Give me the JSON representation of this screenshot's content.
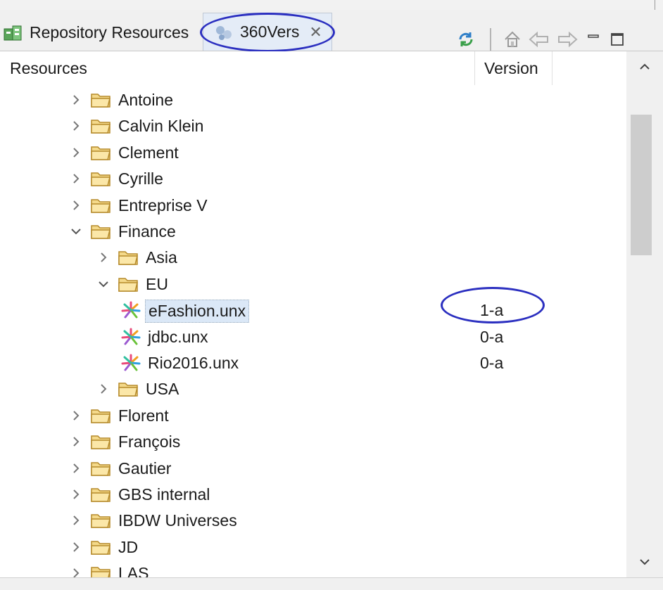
{
  "tabs": {
    "repository_label": "Repository Resources",
    "active_label": "360Vers",
    "active_close": "✕"
  },
  "columns": {
    "resources": "Resources",
    "version": "Version"
  },
  "tree": [
    {
      "label": "Antoine",
      "level": 0,
      "expanded": false,
      "type": "folder",
      "version": ""
    },
    {
      "label": "Calvin Klein",
      "level": 0,
      "expanded": false,
      "type": "folder",
      "version": ""
    },
    {
      "label": "Clement",
      "level": 0,
      "expanded": false,
      "type": "folder",
      "version": ""
    },
    {
      "label": "Cyrille",
      "level": 0,
      "expanded": false,
      "type": "folder",
      "version": ""
    },
    {
      "label": "Entreprise V",
      "level": 0,
      "expanded": false,
      "type": "folder",
      "version": ""
    },
    {
      "label": "Finance",
      "level": 0,
      "expanded": true,
      "type": "folder",
      "version": ""
    },
    {
      "label": "Asia",
      "level": 1,
      "expanded": false,
      "type": "folder",
      "version": ""
    },
    {
      "label": "EU",
      "level": 1,
      "expanded": true,
      "type": "folder",
      "version": ""
    },
    {
      "label": "eFashion.unx",
      "level": 2,
      "type": "universe",
      "version": "1-a",
      "selected": true
    },
    {
      "label": "jdbc.unx",
      "level": 2,
      "type": "universe",
      "version": "0-a"
    },
    {
      "label": "Rio2016.unx",
      "level": 2,
      "type": "universe",
      "version": "0-a"
    },
    {
      "label": "USA",
      "level": 1,
      "expanded": false,
      "type": "folder",
      "version": ""
    },
    {
      "label": "Florent",
      "level": 0,
      "expanded": false,
      "type": "folder",
      "version": ""
    },
    {
      "label": "François",
      "level": 0,
      "expanded": false,
      "type": "folder",
      "version": ""
    },
    {
      "label": "Gautier",
      "level": 0,
      "expanded": false,
      "type": "folder",
      "version": ""
    },
    {
      "label": "GBS internal",
      "level": 0,
      "expanded": false,
      "type": "folder",
      "version": ""
    },
    {
      "label": "IBDW Universes",
      "level": 0,
      "expanded": false,
      "type": "folder",
      "version": ""
    },
    {
      "label": "JD",
      "level": 0,
      "expanded": false,
      "type": "folder",
      "version": ""
    },
    {
      "label": "LAS",
      "level": 0,
      "expanded": false,
      "type": "folder",
      "version": ""
    }
  ],
  "icons": {
    "repository": "repository-icon",
    "tab": "universe-tab-icon",
    "refresh": "refresh-icon",
    "home": "home-icon",
    "back": "back-arrow-icon",
    "forward": "forward-arrow-icon",
    "minimize": "minimize-icon",
    "maximize": "maximize-icon",
    "folder": "folder-icon",
    "universe": "universe-icon"
  },
  "colors": {
    "highlight_ellipse": "#2b2fc0",
    "selection": "#dbe8f7",
    "folder": "#e8b84a"
  }
}
